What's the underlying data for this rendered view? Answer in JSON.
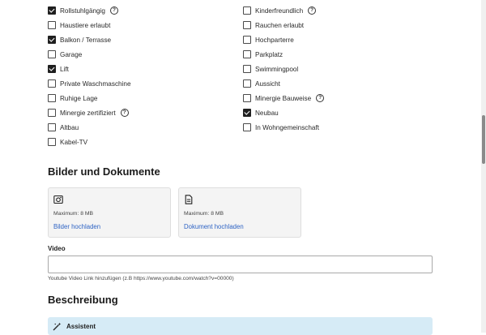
{
  "features": {
    "left": [
      {
        "label": "Rollstuhlgängig",
        "checked": true,
        "help": true
      },
      {
        "label": "Haustiere erlaubt",
        "checked": false,
        "help": false
      },
      {
        "label": "Balkon / Terrasse",
        "checked": true,
        "help": false
      },
      {
        "label": "Garage",
        "checked": false,
        "help": false
      },
      {
        "label": "Lift",
        "checked": true,
        "help": false
      },
      {
        "label": "Private Waschmaschine",
        "checked": false,
        "help": false
      },
      {
        "label": "Ruhige Lage",
        "checked": false,
        "help": false
      },
      {
        "label": "Minergie zertifiziert",
        "checked": false,
        "help": true
      },
      {
        "label": "Altbau",
        "checked": false,
        "help": false
      },
      {
        "label": "Kabel-TV",
        "checked": false,
        "help": false
      }
    ],
    "right": [
      {
        "label": "Kinderfreundlich",
        "checked": false,
        "help": true
      },
      {
        "label": "Rauchen erlaubt",
        "checked": false,
        "help": false
      },
      {
        "label": "Hochparterre",
        "checked": false,
        "help": false
      },
      {
        "label": "Parkplatz",
        "checked": false,
        "help": false
      },
      {
        "label": "Swimmingpool",
        "checked": false,
        "help": false
      },
      {
        "label": "Aussicht",
        "checked": false,
        "help": false
      },
      {
        "label": "Minergie Bauweise",
        "checked": false,
        "help": true
      },
      {
        "label": "Neubau",
        "checked": true,
        "help": false
      },
      {
        "label": "In Wohngemeinschaft",
        "checked": false,
        "help": false
      }
    ],
    "help_glyph": "?"
  },
  "media": {
    "title": "Bilder und Dokumente",
    "images": {
      "max": "Maximum: 8 MB",
      "link": "Bilder hochladen",
      "icon": "camera-icon"
    },
    "documents": {
      "max": "Maximum: 8 MB",
      "link": "Dokument hochladen",
      "icon": "document-icon"
    }
  },
  "video": {
    "label": "Video",
    "value": "",
    "placeholder": "",
    "hint": "Youtube Video Link hinzufügen (z.B https://www.youtube.com/watch?v=00000)"
  },
  "description": {
    "title": "Beschreibung",
    "assistant_label": "Assistent",
    "assistant_icon": "magic-wand-icon"
  },
  "colors": {
    "link": "#2f64c4",
    "assistant_bg": "#d6ebf6",
    "upload_bg": "#f4f4f4"
  }
}
